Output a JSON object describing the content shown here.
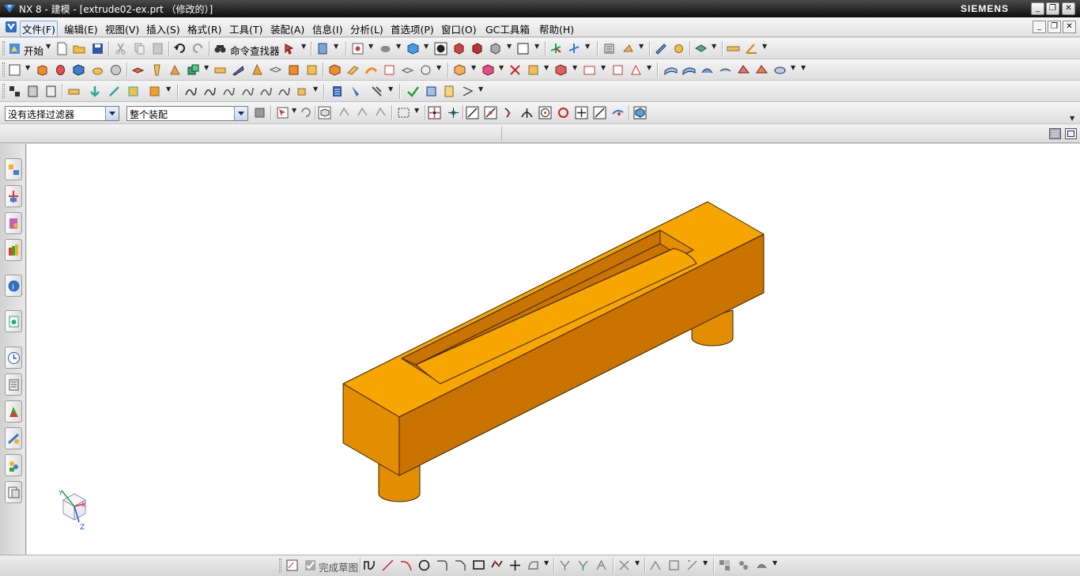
{
  "window": {
    "title": "NX 8 - 建模 - [extrude02-ex.prt （修改的）]",
    "brand": "SIEMENS",
    "minimize": "_",
    "maximize": "❐",
    "close": "✕"
  },
  "menu": {
    "items": [
      {
        "label": "文件(F)",
        "name": "menu-file",
        "active": true
      },
      {
        "label": "编辑(E)",
        "name": "menu-edit"
      },
      {
        "label": "视图(V)",
        "name": "menu-view"
      },
      {
        "label": "插入(S)",
        "name": "menu-insert"
      },
      {
        "label": "格式(R)",
        "name": "menu-format"
      },
      {
        "label": "工具(T)",
        "name": "menu-tools"
      },
      {
        "label": "装配(A)",
        "name": "menu-assembly"
      },
      {
        "label": "信息(I)",
        "name": "menu-info"
      },
      {
        "label": "分析(L)",
        "name": "menu-analysis"
      },
      {
        "label": "首选项(P)",
        "name": "menu-preferences"
      },
      {
        "label": "窗口(O)",
        "name": "menu-window"
      },
      {
        "label": "GC工具箱",
        "name": "menu-gc-toolbox"
      },
      {
        "label": "帮助(H)",
        "name": "menu-help"
      }
    ]
  },
  "standard_toolbar": {
    "start_label": "开始",
    "command_finder_label": "命令查找器"
  },
  "selection_bar": {
    "type_filter": "没有选择过滤器",
    "scope_filter": "整个装配"
  },
  "sketch_toolbar": {
    "finish_sketch_label": "完成草图"
  },
  "colors": {
    "part_top": "#f7a500",
    "part_front": "#c97300",
    "part_side": "#e38e00",
    "part_edge": "#3a2300"
  },
  "triad": {
    "x_label": "X",
    "y_label": "Y",
    "z_label": "Z"
  }
}
